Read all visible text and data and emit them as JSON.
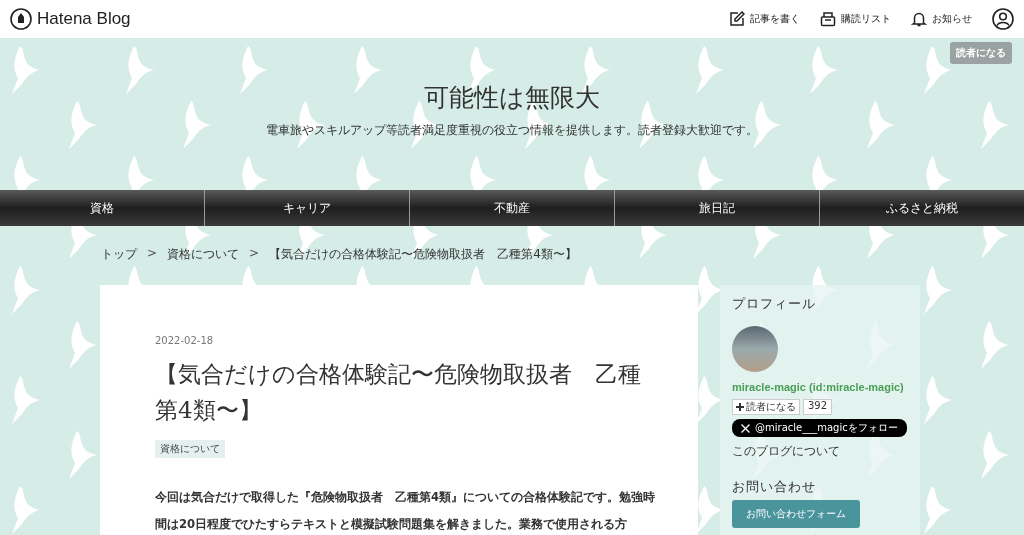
{
  "header": {
    "logo": "Hatena Blog",
    "actions": [
      {
        "kind": "write",
        "label": "記事を書く"
      },
      {
        "kind": "subscriptions",
        "label": "購読リスト"
      },
      {
        "kind": "notifications",
        "label": "お知らせ"
      }
    ]
  },
  "subscribe_button": "読者になる",
  "blog": {
    "title": "可能性は無限大",
    "description": "電車旅やスキルアップ等読者満足度重視の役立つ情報を提供します。読者登録大歓迎です。"
  },
  "nav": [
    "資格",
    "キャリア",
    "不動産",
    "旅日記",
    "ふるさと納税"
  ],
  "breadcrumb": [
    {
      "kind": "link",
      "text": "トップ"
    },
    {
      "kind": "separator",
      "text": ">"
    },
    {
      "kind": "link",
      "text": "資格について"
    },
    {
      "kind": "separator",
      "text": ">"
    },
    {
      "kind": "link",
      "text": "【気合だけの合格体験記〜危険物取扱者　乙種第4類〜】"
    }
  ],
  "article": {
    "date": "2022-02-18",
    "title": "【気合だけの合格体験記〜危険物取扱者　乙種第4類〜】",
    "category": "資格について",
    "body": "今回は気合だけで取得した『危険物取扱者　乙種第4類』についての合格体験記です。勉強時間は20日程度でひたすらテキストと模擬試験問題集を解きました。業務で使用される方"
  },
  "sidebar": {
    "profile": {
      "heading": "プロフィール",
      "name": "miracle-magic (id:miracle-magic)",
      "reader_button": "読者になる",
      "reader_count": "392",
      "follow_button": "@miracle___magicをフォロー",
      "about_link": "このブログについて"
    },
    "contact": {
      "heading": "お問い合わせ",
      "button": "お問い合わせフォーム"
    }
  }
}
